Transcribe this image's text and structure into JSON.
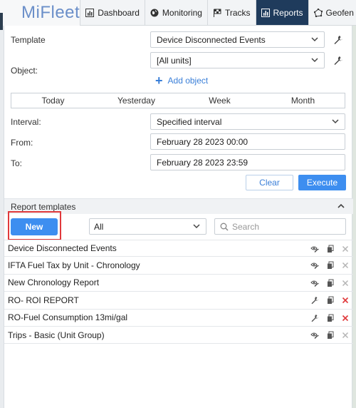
{
  "nav": {
    "logo": "MiFleet",
    "items": [
      {
        "label": "Dashboard",
        "icon": "bar-chart-icon"
      },
      {
        "label": "Monitoring",
        "icon": "globe-icon"
      },
      {
        "label": "Tracks",
        "icon": "flag-icon"
      },
      {
        "label": "Reports",
        "icon": "report-icon",
        "active": true
      },
      {
        "label": "Geofen",
        "icon": "geofence-icon"
      }
    ]
  },
  "form": {
    "template_label": "Template",
    "template_value": "Device Disconnected Events",
    "object_label": "Object:",
    "object_value": "[All units]",
    "add_object": "Add object",
    "periods": [
      "Today",
      "Yesterday",
      "Week",
      "Month"
    ],
    "interval_label": "Interval:",
    "interval_value": "Specified interval",
    "from_label": "From:",
    "from_value": "February 28 2023 00:00",
    "to_label": "To:",
    "to_value": "February 28 2023 23:59",
    "clear": "Clear",
    "execute": "Execute"
  },
  "templates": {
    "header": "Report templates",
    "new_button": "New",
    "filter_value": "All",
    "search_placeholder": "Search",
    "items": [
      {
        "name": "Device Disconnected Events",
        "icons": [
          "eye-wrench",
          "copy",
          "close-grey"
        ]
      },
      {
        "name": "IFTA Fuel Tax by Unit - Chronology",
        "icons": [
          "eye-wrench",
          "copy",
          "close-grey"
        ]
      },
      {
        "name": "New Chronology Report",
        "icons": [
          "eye-wrench",
          "copy",
          "close-grey"
        ]
      },
      {
        "name": "RO- ROI REPORT",
        "icons": [
          "wrench",
          "copy",
          "close-red"
        ]
      },
      {
        "name": "RO-Fuel Consumption 13mi/gal",
        "icons": [
          "wrench",
          "copy",
          "close-red"
        ]
      },
      {
        "name": "Trips - Basic (Unit Group)",
        "icons": [
          "eye-wrench",
          "copy",
          "close-grey"
        ]
      }
    ]
  },
  "colors": {
    "accent": "#3d8ef0",
    "nav_active": "#1f3b5c",
    "highlight": "#e0393b",
    "delete_red": "#e0393b"
  }
}
